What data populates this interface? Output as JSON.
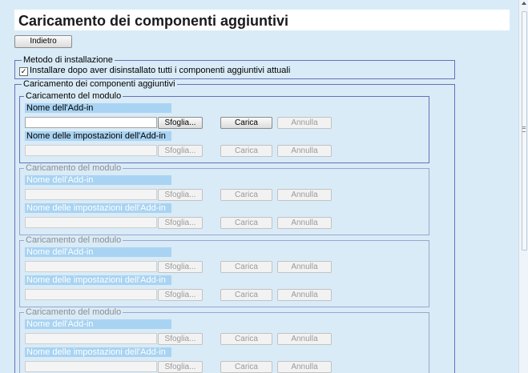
{
  "page": {
    "title": "Caricamento dei componenti aggiuntivi"
  },
  "back_button": {
    "label": "Indietro"
  },
  "install_method": {
    "legend": "Metodo di installazione",
    "checkbox_label": "Installare dopo aver disinstallato tutti i componenti aggiuntivi attuali",
    "checked": true
  },
  "addins": {
    "legend": "Caricamento dei componenti aggiuntivi",
    "modules": [
      {
        "legend": "Caricamento del modulo",
        "enabled": true,
        "addin_name_label": "Nome dell'Add-in",
        "settings_name_label": "Nome delle impostazioni dell'Add-in",
        "browse_label": "Sfoglia...",
        "load_label": "Carica",
        "cancel_label": "Annulla"
      },
      {
        "legend": "Caricamento del modulo",
        "enabled": false,
        "addin_name_label": "Nome dell'Add-in",
        "settings_name_label": "Nome delle impostazioni dell'Add-in",
        "browse_label": "Sfoglia...",
        "load_label": "Carica",
        "cancel_label": "Annulla"
      },
      {
        "legend": "Caricamento del modulo",
        "enabled": false,
        "addin_name_label": "Nome dell'Add-in",
        "settings_name_label": "Nome delle impostazioni dell'Add-in",
        "browse_label": "Sfoglia...",
        "load_label": "Carica",
        "cancel_label": "Annulla"
      },
      {
        "legend": "Caricamento del modulo",
        "enabled": false,
        "addin_name_label": "Nome dell'Add-in",
        "settings_name_label": "Nome delle impostazioni dell'Add-in",
        "browse_label": "Sfoglia...",
        "load_label": "Carica",
        "cancel_label": "Annulla"
      }
    ]
  },
  "icons": {
    "checkmark": "checkmark-icon",
    "scroll_up": "scroll-up-arrow-icon",
    "scroll_grip": "scroll-grip-icon"
  },
  "colors": {
    "background": "#d9ebf7",
    "label_highlight": "#a9d3f2",
    "frame_border": "#6472b8",
    "disabled_text": "#9a9a9a"
  }
}
